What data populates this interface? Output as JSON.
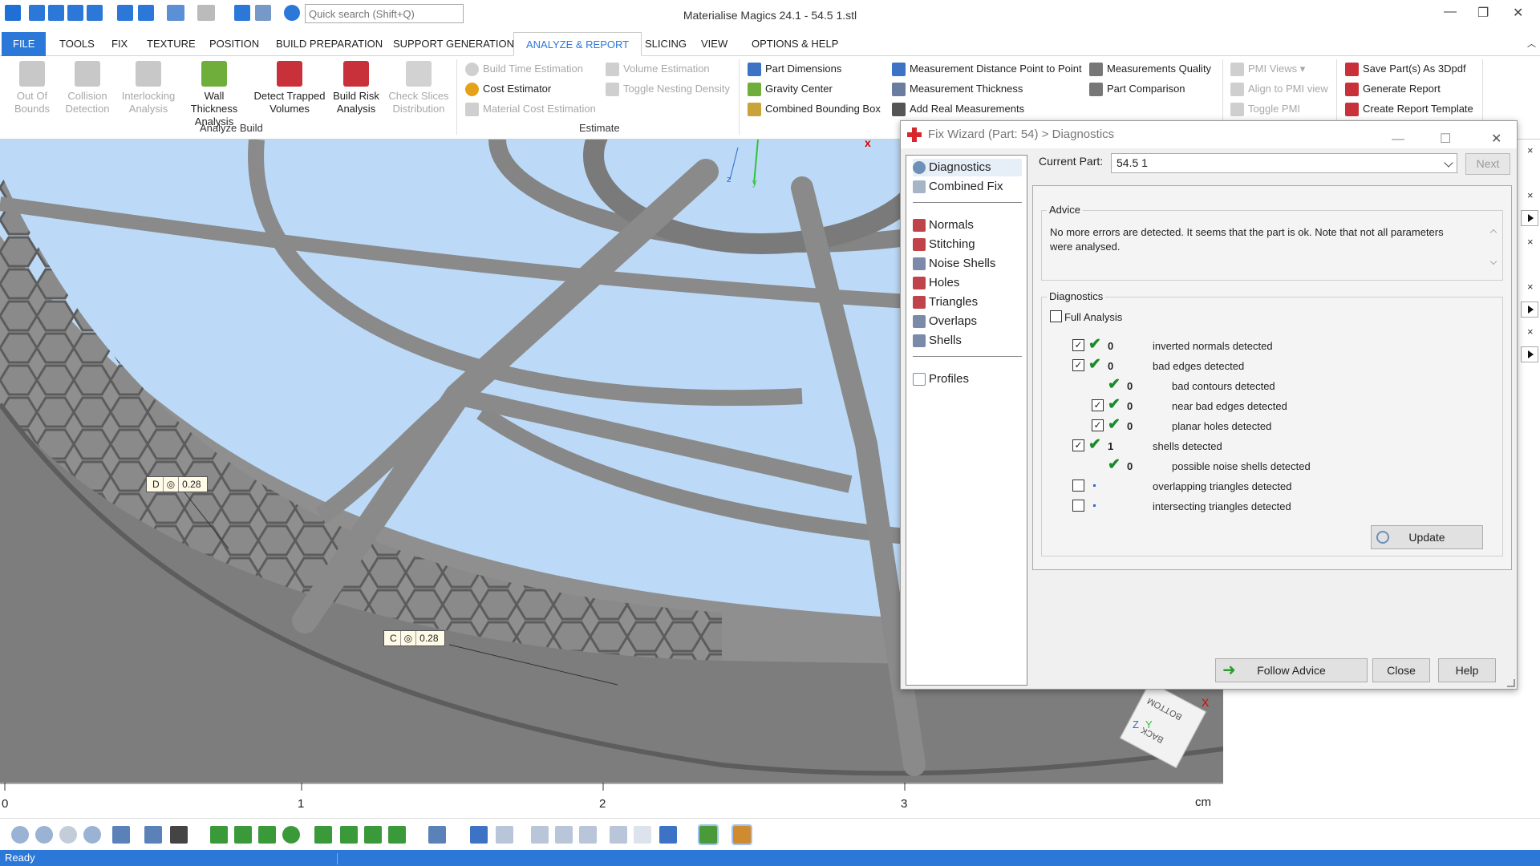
{
  "app": {
    "title": "Materialise Magics 24.1 - 54.5    1.stl"
  },
  "quick_access": {
    "search_placeholder": "Quick search (Shift+Q)"
  },
  "menu": {
    "tabs": [
      "FILE",
      "TOOLS",
      "FIX",
      "TEXTURE",
      "POSITION",
      "BUILD PREPARATION",
      "SUPPORT GENERATION",
      "ANALYZE & REPORT",
      "SLICING",
      "VIEW",
      "OPTIONS & HELP"
    ],
    "active": "ANALYZE & REPORT"
  },
  "ribbon": {
    "analyze_build": {
      "label": "Analyze Build",
      "buttons": [
        {
          "line1": "Out Of",
          "line2": "Bounds",
          "enabled": false
        },
        {
          "line1": "Collision",
          "line2": "Detection",
          "enabled": false
        },
        {
          "line1": "Interlocking",
          "line2": "Analysis",
          "enabled": false
        },
        {
          "line1": "Wall Thickness",
          "line2": "Analysis",
          "enabled": true
        },
        {
          "line1": "Detect Trapped",
          "line2": "Volumes",
          "enabled": true
        },
        {
          "line1": "Build Risk",
          "line2": "Analysis",
          "enabled": true
        },
        {
          "line1": "Check Slices",
          "line2": "Distribution",
          "enabled": false
        }
      ]
    },
    "estimate": {
      "label": "Estimate",
      "items": [
        {
          "label": "Build Time Estimation",
          "enabled": false
        },
        {
          "label": "Cost Estimator",
          "enabled": true
        },
        {
          "label": "Material Cost Estimation",
          "enabled": false
        },
        {
          "label": "Volume Estimation",
          "enabled": false
        },
        {
          "label": "Toggle Nesting Density",
          "enabled": false
        }
      ]
    },
    "measure": {
      "items": [
        "Part Dimensions",
        "Gravity Center",
        "Combined Bounding Box",
        "Measurement Distance Point to Point",
        "Measurement Thickness",
        "Add Real Measurements",
        "Measurements Quality",
        "Part Comparison"
      ]
    },
    "pmi": {
      "items": [
        "PMI Views",
        "Align to PMI view",
        "Toggle PMI"
      ]
    },
    "report": {
      "items": [
        "Save Part(s) As 3Dpdf",
        "Generate Report",
        "Create Report Template"
      ]
    }
  },
  "viewport": {
    "dimension_labels": [
      {
        "letter": "D",
        "symbol": "◎",
        "value": "0.28"
      },
      {
        "letter": "C",
        "symbol": "◎",
        "value": "0.28"
      }
    ],
    "close_mark": "x",
    "axis_z": "z",
    "axis_y": "y",
    "cube_labels": [
      "BOTTOM",
      "BACK"
    ],
    "cube_axes": {
      "z": "Z",
      "y": "Y",
      "x": "X"
    }
  },
  "ruler": {
    "ticks": [
      "0",
      "1",
      "2",
      "3"
    ],
    "unit": "cm"
  },
  "dialog": {
    "title": "Fix Wizard (Part: 54) > Diagnostics",
    "nav": [
      {
        "label": "Diagnostics",
        "selected": true
      },
      {
        "label": "Combined Fix",
        "selected": false
      },
      {
        "label": "Normals",
        "selected": false
      },
      {
        "label": "Stitching",
        "selected": false
      },
      {
        "label": "Noise Shells",
        "selected": false
      },
      {
        "label": "Holes",
        "selected": false
      },
      {
        "label": "Triangles",
        "selected": false
      },
      {
        "label": "Overlaps",
        "selected": false
      },
      {
        "label": "Shells",
        "selected": false
      },
      {
        "label": "Profiles",
        "selected": false
      }
    ],
    "current_part_label": "Current Part:",
    "current_part_value": "54.5   1",
    "next_label": "Next",
    "advice": {
      "legend": "Advice",
      "text": "No more errors are detected. It seems that the part is ok. Note that not all parameters were analysed."
    },
    "diagnostics": {
      "legend": "Diagnostics",
      "full_analysis_label": "Full Analysis",
      "full_analysis_checked": false,
      "rows": [
        {
          "checked": true,
          "count": "0",
          "label": "inverted normals detected",
          "ok": true,
          "indent": 0
        },
        {
          "checked": true,
          "count": "0",
          "label": "bad edges detected",
          "ok": true,
          "indent": 0
        },
        {
          "checked": null,
          "count": "0",
          "label": "bad contours detected",
          "ok": true,
          "indent": 1
        },
        {
          "checked": true,
          "count": "0",
          "label": "near bad edges detected",
          "ok": true,
          "indent": 1
        },
        {
          "checked": true,
          "count": "0",
          "label": "planar holes detected",
          "ok": true,
          "indent": 1
        },
        {
          "checked": true,
          "count": "1",
          "label": "shells detected",
          "ok": true,
          "indent": 0
        },
        {
          "checked": null,
          "count": "0",
          "label": "possible noise shells detected",
          "ok": true,
          "indent": 1
        },
        {
          "checked": false,
          "count": "",
          "label": "overlapping triangles detected",
          "ok": false,
          "indent": 0
        },
        {
          "checked": false,
          "count": "",
          "label": "intersecting triangles detected",
          "ok": false,
          "indent": 0
        }
      ],
      "update_label": "Update"
    },
    "buttons": {
      "follow_advice": "Follow Advice",
      "close": "Close",
      "help": "Help"
    }
  },
  "status": {
    "text": "Ready"
  }
}
